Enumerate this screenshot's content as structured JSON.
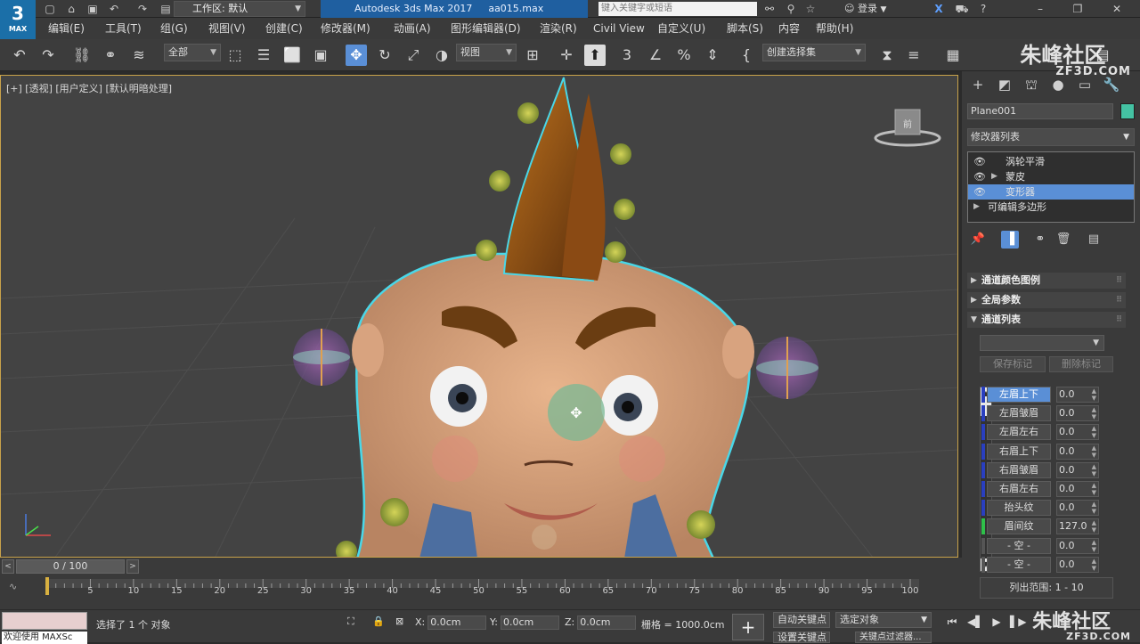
{
  "app": {
    "logo_label": "3",
    "logo_sub": "MAX",
    "workspace_label": "工作区: 默认",
    "title": "Autodesk 3ds Max 2017",
    "file": "aa015.max",
    "search_placeholder": "键入关键字或短语",
    "login": "登录"
  },
  "menu": [
    "编辑(E)",
    "工具(T)",
    "组(G)",
    "视图(V)",
    "创建(C)",
    "修改器(M)",
    "动画(A)",
    "图形编辑器(D)",
    "渲染(R)",
    "Civil View",
    "自定义(U)",
    "脚本(S)",
    "内容",
    "帮助(H)"
  ],
  "toolbar": {
    "selection_filter": "全部",
    "ref_coord": "视图",
    "named_selection": "创建选择集"
  },
  "viewport": {
    "label": "[+] [透视] [用户定义] [默认明暗处理]",
    "viewcube_label": "前"
  },
  "panel": {
    "object_name": "Plane001",
    "object_color": "#44c2a3",
    "modifier_list": "修改器列表",
    "stack": [
      {
        "label": "涡轮平滑",
        "eye": true,
        "arrow": false,
        "selected": false
      },
      {
        "label": "蒙皮",
        "eye": true,
        "arrow": true,
        "selected": false
      },
      {
        "label": "变形器",
        "eye": true,
        "arrow": false,
        "selected": true
      },
      {
        "label": "可编辑多边形",
        "eye": false,
        "arrow": true,
        "selected": false
      }
    ],
    "rollouts": [
      "通道颜色图例",
      "全局参数",
      "通道列表"
    ],
    "save_marker": "保存标记",
    "delete_marker": "删除标记",
    "channels": [
      {
        "name": "左眉上下",
        "value": "0.0",
        "selected": true,
        "color": "blue"
      },
      {
        "name": "左眉皱眉",
        "value": "0.0",
        "selected": false,
        "color": "blue"
      },
      {
        "name": "左眉左右",
        "value": "0.0",
        "selected": false,
        "color": "blue"
      },
      {
        "name": "右眉上下",
        "value": "0.0",
        "selected": false,
        "color": "blue"
      },
      {
        "name": "右眉皱眉",
        "value": "0.0",
        "selected": false,
        "color": "blue"
      },
      {
        "name": "右眉左右",
        "value": "0.0",
        "selected": false,
        "color": "blue"
      },
      {
        "name": "抬头纹",
        "value": "0.0",
        "selected": false,
        "color": "blue"
      },
      {
        "name": "眉间纹",
        "value": "127.0",
        "selected": false,
        "color": "green"
      },
      {
        "name": "- 空 -",
        "value": "0.0",
        "selected": false,
        "color": "none"
      },
      {
        "name": "- 空 -",
        "value": "0.0",
        "selected": false,
        "color": "none"
      }
    ],
    "list_range": "列出范围:     1 - 10"
  },
  "timeline": {
    "frame": "0 / 100",
    "ticks": [
      "5",
      "10",
      "15",
      "20",
      "25",
      "30",
      "35",
      "40",
      "45",
      "50",
      "55",
      "60",
      "65",
      "70",
      "75",
      "80",
      "85",
      "90",
      "95",
      "100"
    ]
  },
  "status": {
    "maxscript": "欢迎使用 MAXSc",
    "selection_text": "选择了 1 个 对象",
    "x": "0.0cm",
    "y": "0.0cm",
    "z": "0.0cm",
    "grid": "栅格 = 1000.0cm",
    "auto_key": "自动关键点",
    "set_key": "设置关键点",
    "selected_object": "选定对象",
    "key_filter": "关键点过滤器..."
  },
  "watermark": {
    "top": "朱峰社区",
    "top_sub": "ZF3D.COM",
    "bottom": "朱峰社区",
    "bottom_sub": "ZF3D.COM"
  }
}
